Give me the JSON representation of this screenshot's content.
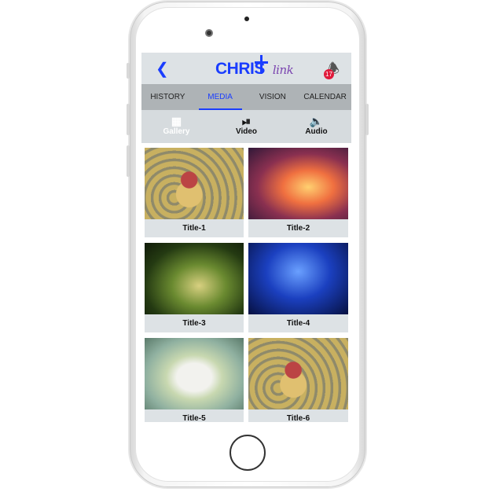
{
  "header": {
    "back_icon": "chevron-left-icon",
    "logo_text": "CHRIS",
    "logo_script": "link",
    "notification_count": "17"
  },
  "tabs": [
    {
      "label": "HISTORY"
    },
    {
      "label": "MEDIA",
      "active": true
    },
    {
      "label": "VISION"
    },
    {
      "label": "CALENDAR"
    }
  ],
  "subtabs": [
    {
      "label": "Gallery",
      "icon": "grid-icon",
      "active": true
    },
    {
      "label": "Video",
      "icon": "play-circle-icon"
    },
    {
      "label": "Audio",
      "icon": "speaker-icon"
    }
  ],
  "gallery": [
    {
      "title": "Title-1"
    },
    {
      "title": "Title-2"
    },
    {
      "title": "Title-3"
    },
    {
      "title": "Title-4"
    },
    {
      "title": "Title-5"
    },
    {
      "title": "Title-6"
    }
  ],
  "colors": {
    "accent": "#1a3dff",
    "badge": "#e0193a"
  }
}
